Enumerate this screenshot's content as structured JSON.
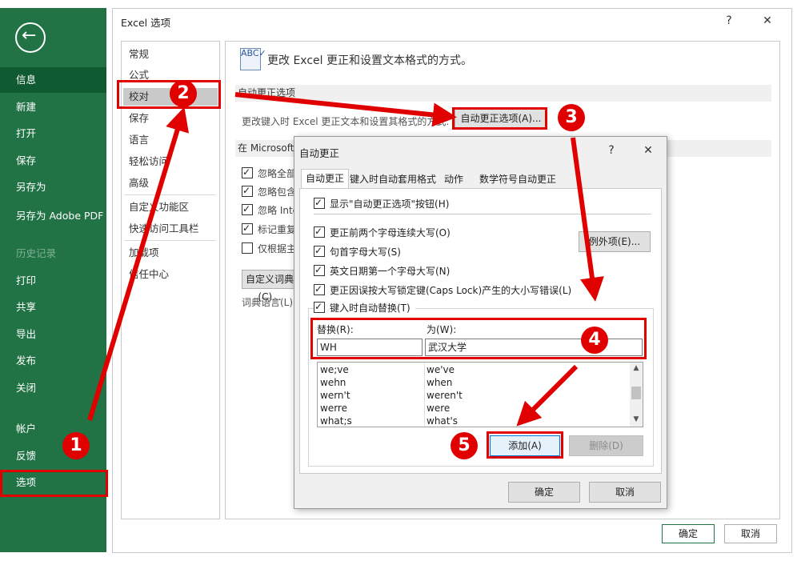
{
  "backstage": {
    "items": [
      "信息",
      "新建",
      "打开",
      "保存",
      "另存为",
      "另存为 Adobe PDF",
      "历史记录",
      "打印",
      "共享",
      "导出",
      "发布",
      "关闭",
      "帐户",
      "反馈",
      "选项"
    ]
  },
  "options_dialog": {
    "title": "Excel 选项",
    "help": "?",
    "close": "✕",
    "categories": [
      "常规",
      "公式",
      "校对",
      "保存",
      "语言",
      "轻松访问",
      "高级",
      "自定义功能区",
      "快速访问工具栏",
      "加载项",
      "信任中心"
    ],
    "selected_category": "校对",
    "header_icon": "ABC✓",
    "header_text": "更改 Excel 更正和设置文本格式的方式。",
    "autocorrect_section": "自动更正选项",
    "autocorrect_desc": "更改键入时 Excel 更正文本和设置其格式的方式:",
    "autocorrect_button": "自动更正选项(A)...",
    "office_section": "在 Microsoft Office 程序中更正拼写时",
    "checkboxes": [
      {
        "label": "忽略全部大写的单词(U)",
        "checked": true
      },
      {
        "label": "忽略包含数字的单词(B)",
        "checked": true
      },
      {
        "label": "忽略 Internet 和文件地址(H)",
        "checked": true
      },
      {
        "label": "标记重复单词(R)",
        "checked": true
      },
      {
        "label": "仅根据主词典提供建议(I)",
        "checked": false
      }
    ],
    "custom_dict_button": "自定义词典(C)...",
    "dict_language": "词典语言(L):",
    "ok": "确定",
    "cancel": "取消"
  },
  "autocorrect_dialog": {
    "title": "自动更正",
    "help": "?",
    "close": "✕",
    "tabs": [
      "自动更正",
      "键入时自动套用格式",
      "动作",
      "数学符号自动更正"
    ],
    "show_buttons": {
      "label": "显示\"自动更正选项\"按钮(H)",
      "checked": true
    },
    "options": [
      {
        "label": "更正前两个字母连续大写(O)",
        "checked": true
      },
      {
        "label": "句首字母大写(S)",
        "checked": true
      },
      {
        "label": "英文日期第一个字母大写(N)",
        "checked": true
      },
      {
        "label": "更正因误按大写锁定键(Caps Lock)产生的大小写错误(L)",
        "checked": true
      }
    ],
    "exceptions_button": "例外项(E)...",
    "replace_as_type": {
      "label": "键入时自动替换(T)",
      "checked": true
    },
    "replace_label": "替换(R):",
    "with_label": "为(W):",
    "replace_value": "WH",
    "with_value": "武汉大学",
    "list": [
      {
        "replace": "we;ve",
        "with": "we've"
      },
      {
        "replace": "wehn",
        "with": "when"
      },
      {
        "replace": "wern't",
        "with": "weren't"
      },
      {
        "replace": "werre",
        "with": "were"
      },
      {
        "replace": "what;s",
        "with": "what's"
      }
    ],
    "add_button": "添加(A)",
    "delete_button": "删除(D)",
    "ok": "确定",
    "cancel": "取消"
  },
  "annotations": {
    "steps": [
      "1",
      "2",
      "3",
      "4",
      "5"
    ],
    "color": "#e00000"
  }
}
